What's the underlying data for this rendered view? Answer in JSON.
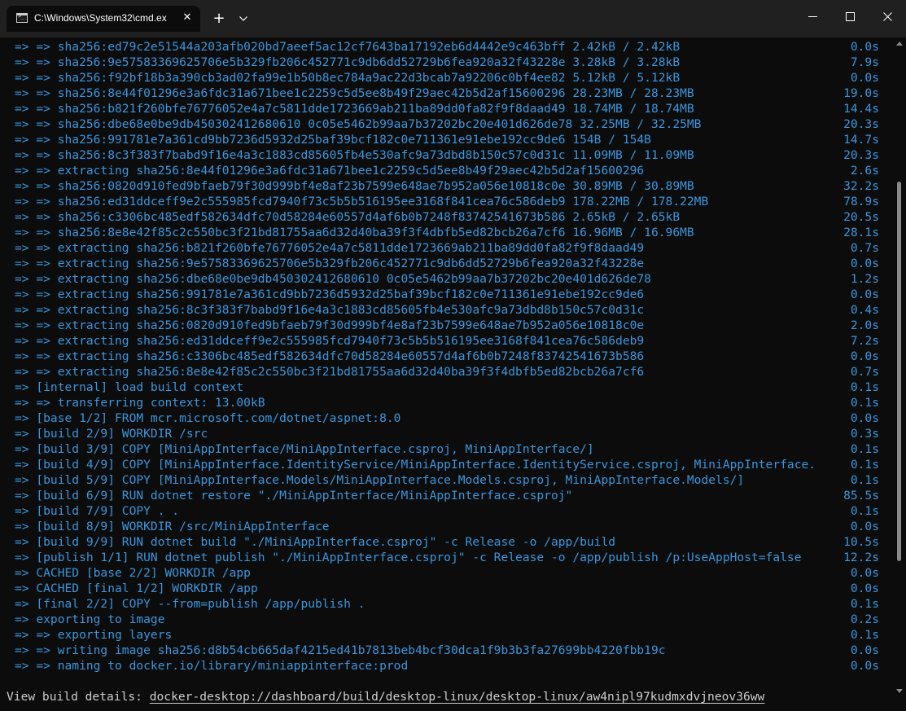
{
  "window": {
    "tab_title": "C:\\Windows\\System32\\cmd.ex",
    "colors": {
      "output": "#3a96dd",
      "plain_text": "#cccccc",
      "background": "#0c0c0c",
      "titlebar": "#202020"
    }
  },
  "output_lines": [
    {
      "text": "=> => sha256:ed79c2e51544a203afb020bd7aeef5ac12cf7643ba17192eb6d4442e9c463bff 2.42kB / 2.42kB",
      "time": "0.0s"
    },
    {
      "text": "=> => sha256:9e57583369625706e5b329fb206c452771c9db6dd52729b6fea920a32f43228e 3.28kB / 3.28kB",
      "time": "7.9s"
    },
    {
      "text": "=> => sha256:f92bf18b3a390cb3ad02fa99e1b50b8ec784a9ac22d3bcab7a92206c0bf4ee82 5.12kB / 5.12kB",
      "time": "0.0s"
    },
    {
      "text": "=> => sha256:8e44f01296e3a6fdc31a671bee1c2259c5d5ee8b49f29aec42b5d2af15600296 28.23MB / 28.23MB",
      "time": "19.0s"
    },
    {
      "text": "=> => sha256:b821f260bfe76776052e4a7c5811dde1723669ab211ba89dd0fa82f9f8daad49 18.74MB / 18.74MB",
      "time": "14.4s"
    },
    {
      "text": "=> => sha256:dbe68e0be9db450302412680610 0c05e5462b99aa7b37202bc20e401d626de78 32.25MB / 32.25MB",
      "time": "20.3s"
    },
    {
      "text": "=> => sha256:991781e7a361cd9bb7236d5932d25baf39bcf182c0e711361e91ebe192cc9de6 154B / 154B",
      "time": "14.7s"
    },
    {
      "text": "=> => sha256:8c3f383f7babd9f16e4a3c1883cd85605fb4e530afc9a73dbd8b150c57c0d31c 11.09MB / 11.09MB",
      "time": "20.3s"
    },
    {
      "text": "=> => extracting sha256:8e44f01296e3a6fdc31a671bee1c2259c5d5ee8b49f29aec42b5d2af15600296",
      "time": "2.6s"
    },
    {
      "text": "=> => sha256:0820d910fed9bfaeb79f30d999bf4e8af23b7599e648ae7b952a056e10818c0e 30.89MB / 30.89MB",
      "time": "32.2s"
    },
    {
      "text": "=> => sha256:ed31ddceff9e2c555985fcd7940f73c5b5b516195ee3168f841cea76c586deb9 178.22MB / 178.22MB",
      "time": "78.9s"
    },
    {
      "text": "=> => sha256:c3306bc485edf582634dfc70d58284e60557d4af6b0b7248f83742541673b586 2.65kB / 2.65kB",
      "time": "20.5s"
    },
    {
      "text": "=> => sha256:8e8e42f85c2c550bc3f21bd81755aa6d32d40ba39f3f4dbfb5ed82bcb26a7cf6 16.96MB / 16.96MB",
      "time": "28.1s"
    },
    {
      "text": "=> => extracting sha256:b821f260bfe76776052e4a7c5811dde1723669ab211ba89dd0fa82f9f8daad49",
      "time": "0.7s"
    },
    {
      "text": "=> => extracting sha256:9e57583369625706e5b329fb206c452771c9db6dd52729b6fea920a32f43228e",
      "time": "0.0s"
    },
    {
      "text": "=> => extracting sha256:dbe68e0be9db450302412680610 0c05e5462b99aa7b37202bc20e401d626de78",
      "time": "1.2s"
    },
    {
      "text": "=> => extracting sha256:991781e7a361cd9bb7236d5932d25baf39bcf182c0e711361e91ebe192cc9de6",
      "time": "0.0s"
    },
    {
      "text": "=> => extracting sha256:8c3f383f7babd9f16e4a3c1883cd85605fb4e530afc9a73dbd8b150c57c0d31c",
      "time": "0.4s"
    },
    {
      "text": "=> => extracting sha256:0820d910fed9bfaeb79f30d999bf4e8af23b7599e648ae7b952a056e10818c0e",
      "time": "2.0s"
    },
    {
      "text": "=> => extracting sha256:ed31ddceff9e2c555985fcd7940f73c5b5b516195ee3168f841cea76c586deb9",
      "time": "7.2s"
    },
    {
      "text": "=> => extracting sha256:c3306bc485edf582634dfc70d58284e60557d4af6b0b7248f83742541673b586",
      "time": "0.0s"
    },
    {
      "text": "=> => extracting sha256:8e8e42f85c2c550bc3f21bd81755aa6d32d40ba39f3f4dbfb5ed82bcb26a7cf6",
      "time": "0.7s"
    },
    {
      "text": "=> [internal] load build context",
      "time": "0.1s"
    },
    {
      "text": "=> => transferring context: 13.00kB",
      "time": "0.1s"
    },
    {
      "text": "=> [base 1/2] FROM mcr.microsoft.com/dotnet/aspnet:8.0",
      "time": "0.0s"
    },
    {
      "text": "=> [build 2/9] WORKDIR /src",
      "time": "0.3s"
    },
    {
      "text": "=> [build 3/9] COPY [MiniAppInterface/MiniAppInterface.csproj, MiniAppInterface/]",
      "time": "0.1s"
    },
    {
      "text": "=> [build 4/9] COPY [MiniAppInterface.IdentityService/MiniAppInterface.IdentityService.csproj, MiniAppInterface.",
      "time": "0.1s"
    },
    {
      "text": "=> [build 5/9] COPY [MiniAppInterface.Models/MiniAppInterface.Models.csproj, MiniAppInterface.Models/]",
      "time": "0.1s"
    },
    {
      "text": "=> [build 6/9] RUN dotnet restore \"./MiniAppInterface/MiniAppInterface.csproj\"",
      "time": "85.5s"
    },
    {
      "text": "=> [build 7/9] COPY . .",
      "time": "0.1s"
    },
    {
      "text": "=> [build 8/9] WORKDIR /src/MiniAppInterface",
      "time": "0.0s"
    },
    {
      "text": "=> [build 9/9] RUN dotnet build \"./MiniAppInterface.csproj\" -c Release -o /app/build",
      "time": "10.5s"
    },
    {
      "text": "=> [publish 1/1] RUN dotnet publish \"./MiniAppInterface.csproj\" -c Release -o /app/publish /p:UseAppHost=false",
      "time": "12.2s"
    },
    {
      "text": "=> CACHED [base 2/2] WORKDIR /app",
      "time": "0.0s"
    },
    {
      "text": "=> CACHED [final 1/2] WORKDIR /app",
      "time": "0.0s"
    },
    {
      "text": "=> [final 2/2] COPY --from=publish /app/publish .",
      "time": "0.1s"
    },
    {
      "text": "=> exporting to image",
      "time": "0.2s"
    },
    {
      "text": "=> => exporting layers",
      "time": "0.1s"
    },
    {
      "text": "=> => writing image sha256:d8b54cb665daf4215ed41b7813beb4bcf30dca1f9b3b3fa27699bb4220fbb19c",
      "time": "0.0s"
    },
    {
      "text": "=> => naming to docker.io/library/miniappinterface:prod",
      "time": "0.0s"
    }
  ],
  "footer": {
    "prefix": "View build details: ",
    "link": "docker-desktop://dashboard/build/desktop-linux/desktop-linux/aw4nipl97kudmxdvjneov36ww"
  }
}
